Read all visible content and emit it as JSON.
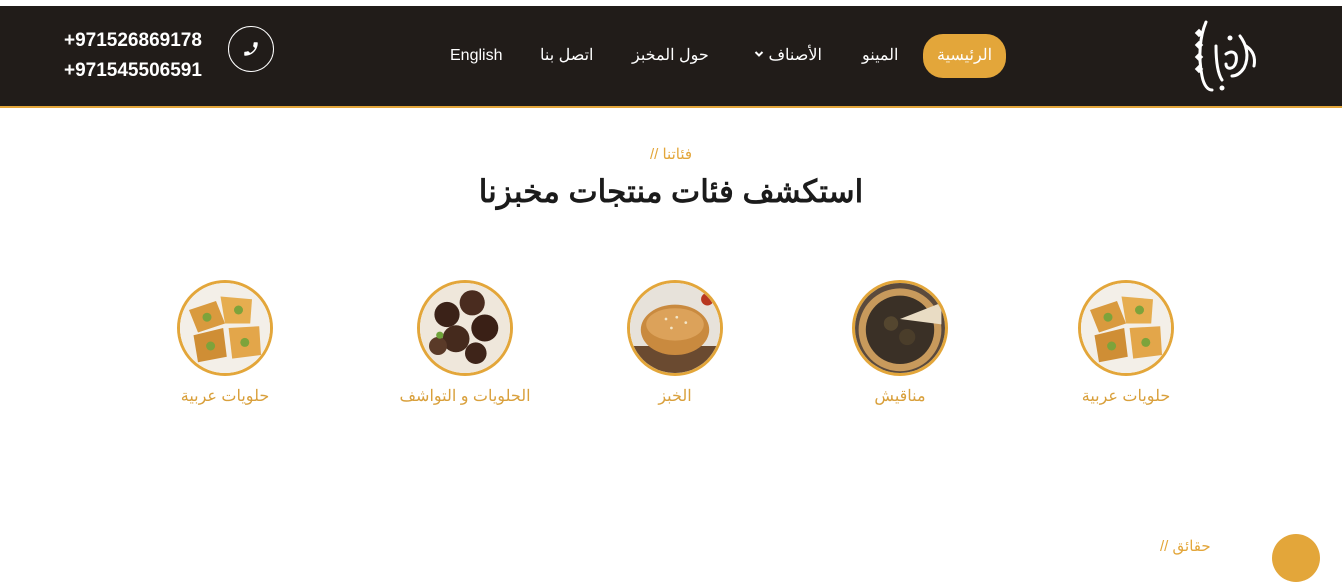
{
  "header": {
    "logo_text": "الكوفية",
    "nav": {
      "home": "الرئيسية",
      "menu": "المينو",
      "categories": "الأصناف",
      "about": "حول المخبز",
      "contact": "اتصل بنا",
      "language": "English"
    },
    "phones": [
      "+971526869178",
      "+971545506591"
    ]
  },
  "categories_section": {
    "eyebrow": "// فئاتنا",
    "title": "استكشف فئات منتجات مخبزنا",
    "items": [
      {
        "label": "حلويات عربية",
        "icon": "baklava-image"
      },
      {
        "label": "مناقيش",
        "icon": "manakish-image"
      },
      {
        "label": "الخبز",
        "icon": "bread-image"
      },
      {
        "label": "الحلويات و التواشف",
        "icon": "chocolate-sweets-image"
      },
      {
        "label": "حلويات عربية",
        "icon": "baklava-image"
      }
    ]
  },
  "facts_section": {
    "eyebrow": "// حقائق"
  },
  "colors": {
    "accent": "#e3a63a",
    "header_bg": "#211c19"
  }
}
